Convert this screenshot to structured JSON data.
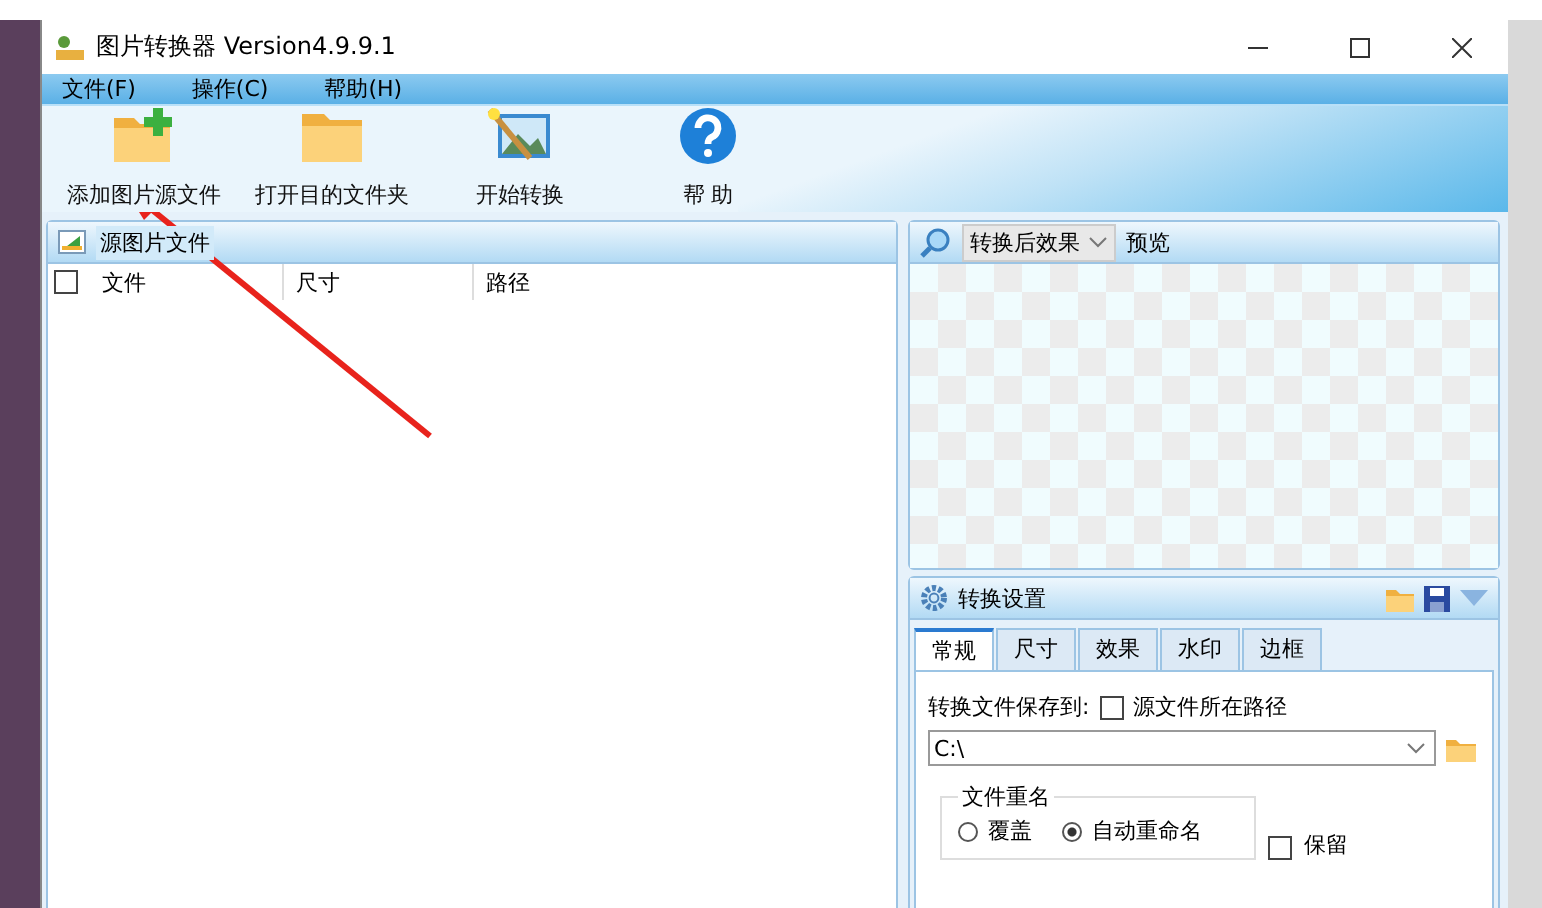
{
  "window": {
    "title": "图片转换器 Version4.9.9.1"
  },
  "menu": [
    {
      "label": "文件(F)"
    },
    {
      "label": "操作(C)"
    },
    {
      "label": "帮助(H)"
    }
  ],
  "toolbar": [
    {
      "label": "添加图片源文件",
      "kind": "add"
    },
    {
      "label": "打开目的文件夹",
      "kind": "folder"
    },
    {
      "label": "开始转换",
      "kind": "convert"
    },
    {
      "label": "帮 助",
      "kind": "help"
    }
  ],
  "source_panel": {
    "title": "源图片文件",
    "select_all_checked": false,
    "columns": [
      "文件",
      "尺寸",
      "路径"
    ]
  },
  "preview_panel": {
    "mode": "转换后效果",
    "label": "预览"
  },
  "settings": {
    "title": "转换设置",
    "tabs": [
      {
        "label": "常规",
        "selected": true
      },
      {
        "label": "尺寸",
        "selected": false
      },
      {
        "label": "效果",
        "selected": false
      },
      {
        "label": "水印",
        "selected": false
      },
      {
        "label": "边框",
        "selected": false
      }
    ],
    "save_to_label": "转换文件保存到:",
    "source_path": {
      "label": "源文件所在路径",
      "checked": false
    },
    "path": "C:\\",
    "rename": {
      "title": "文件重名",
      "options": [
        {
          "label": "覆盖",
          "selected": false
        },
        {
          "label": "自动重命名",
          "selected": true
        }
      ]
    },
    "keep": {
      "label": "保留",
      "checked": false
    }
  }
}
